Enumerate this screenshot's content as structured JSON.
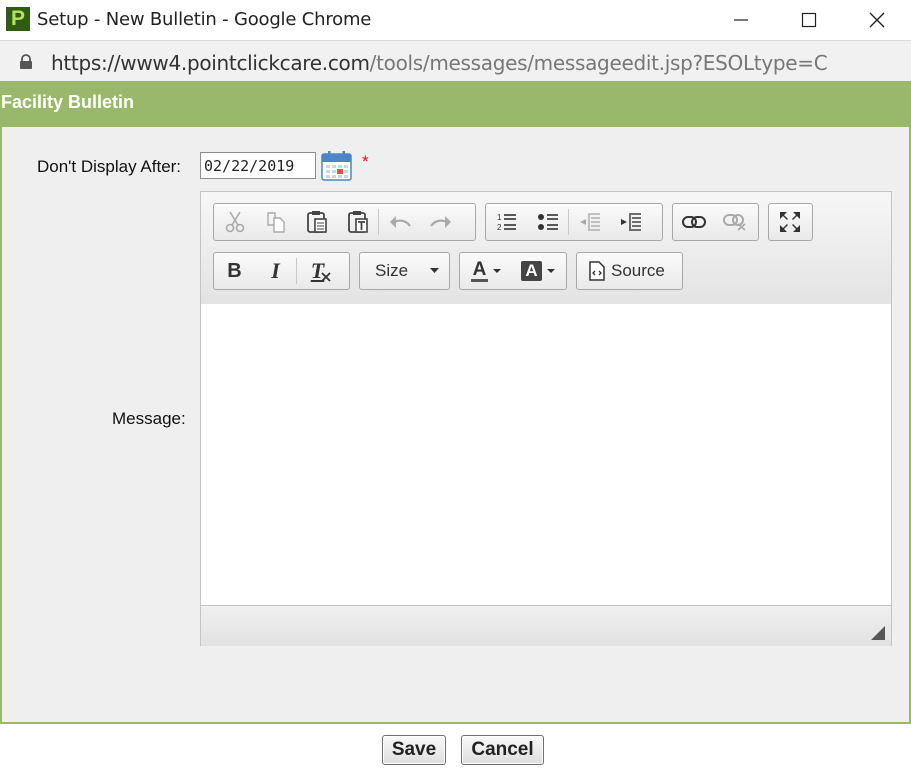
{
  "window": {
    "title": "Setup - New Bulletin - Google Chrome",
    "logo_letter": "P"
  },
  "address": {
    "host": "https://www4.pointclickcare.com",
    "path": "/tools/messages/messageedit.jsp?ESOLtype=C"
  },
  "header": {
    "title": "Facility Bulletin"
  },
  "form": {
    "date_label": "Don't Display After:",
    "date_value": "02/22/2019",
    "required_mark": "*",
    "message_label": "Message:"
  },
  "editor": {
    "toolbar_row1": [
      "cut-icon",
      "copy-icon",
      "paste-icon",
      "paste-text-icon",
      "undo-icon",
      "redo-icon",
      "numbered-list-icon",
      "bulleted-list-icon",
      "decrease-indent-icon",
      "increase-indent-icon",
      "link-icon",
      "unlink-icon",
      "maximize-icon"
    ],
    "bold_label": "B",
    "italic_label": "I",
    "remove_format_label": "T",
    "size_label": "Size",
    "text_color_label": "A",
    "bg_color_label": "A",
    "source_label": "Source",
    "content": ""
  },
  "buttons": {
    "save": "Save",
    "cancel": "Cancel"
  },
  "colors": {
    "header_green": "#9ab86c",
    "required_red": "#dd1111"
  }
}
